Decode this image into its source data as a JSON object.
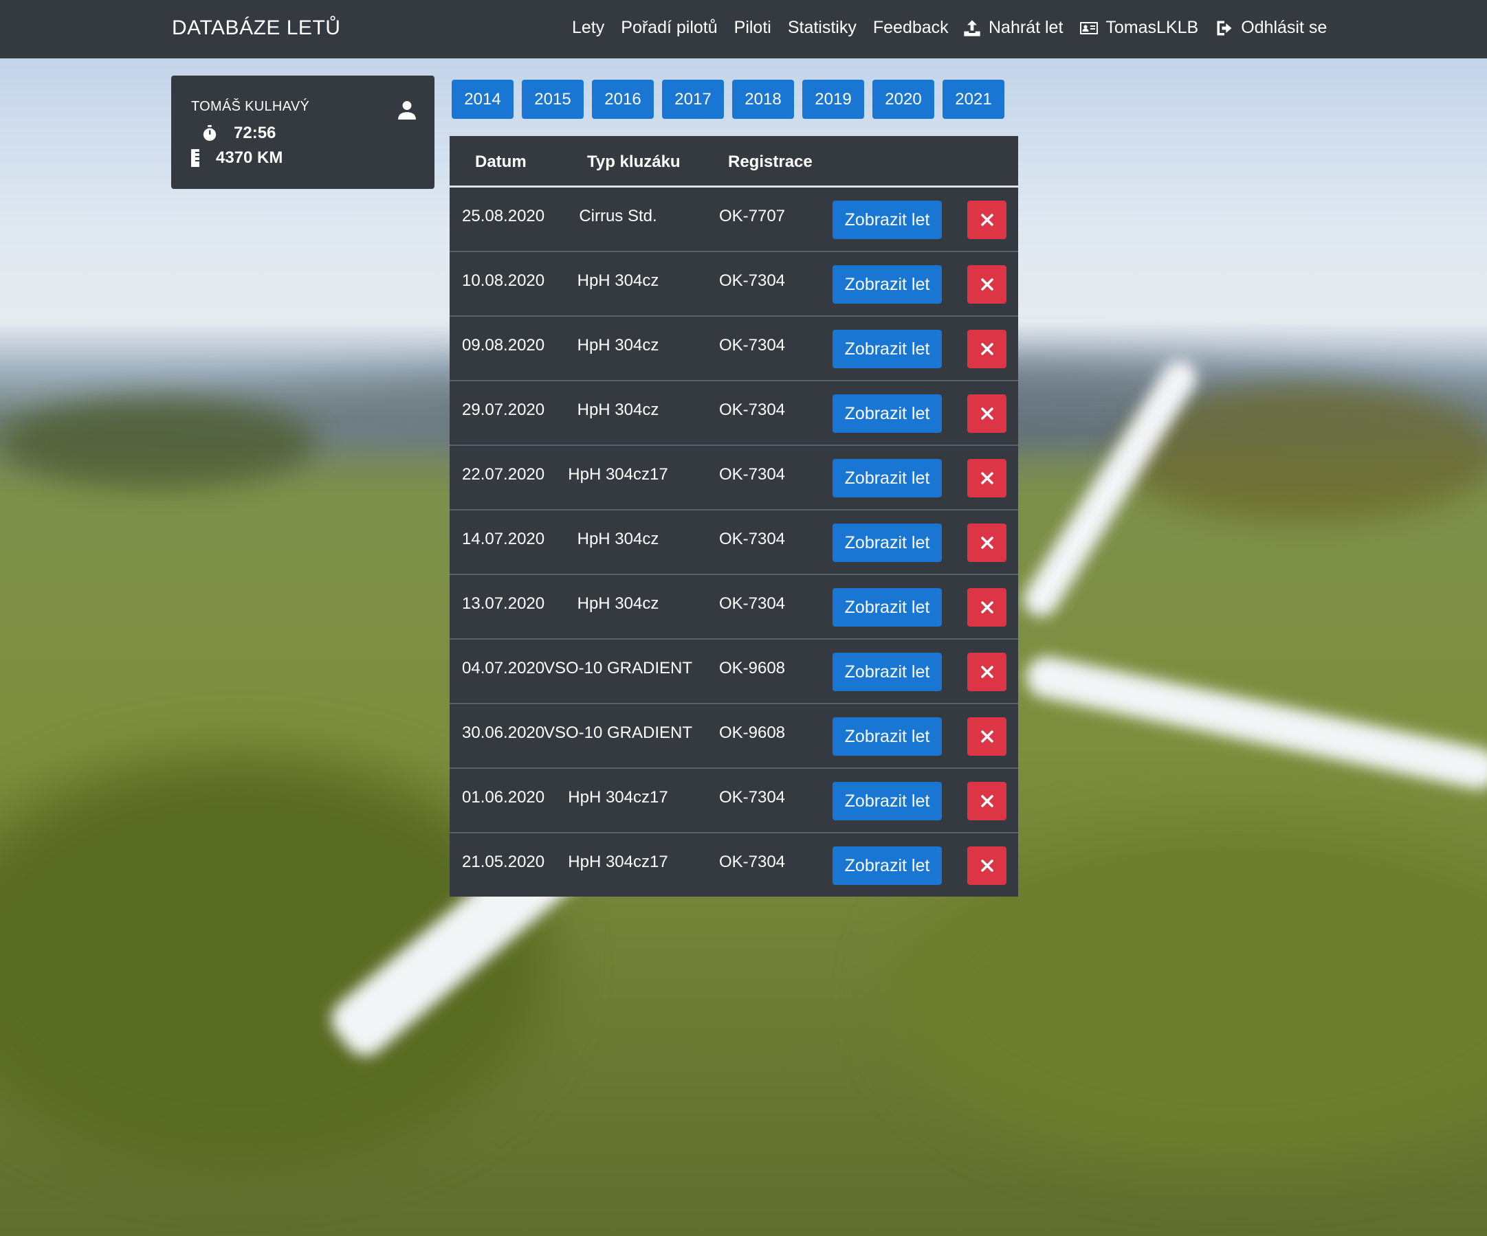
{
  "navbar": {
    "brand": "DATABÁZE LETŮ",
    "links": [
      "Lety",
      "Pořadí pilotů",
      "Piloti",
      "Statistiky",
      "Feedback"
    ],
    "upload_label": "Nahrát let",
    "user_label": "TomasLKLB",
    "logout_label": "Odhlásit se"
  },
  "profile": {
    "name": "TOMÁŠ KULHAVÝ",
    "time": "72:56",
    "distance": "4370 KM"
  },
  "years": [
    "2014",
    "2015",
    "2016",
    "2017",
    "2018",
    "2019",
    "2020",
    "2021"
  ],
  "table": {
    "headers": [
      "Datum",
      "Typ kluzáku",
      "Registrace"
    ],
    "view_label": "Zobrazit let",
    "rows": [
      {
        "date": "25.08.2020",
        "type": "Cirrus Std.",
        "reg": "OK-7707"
      },
      {
        "date": "10.08.2020",
        "type": "HpH 304cz",
        "reg": "OK-7304"
      },
      {
        "date": "09.08.2020",
        "type": "HpH 304cz",
        "reg": "OK-7304"
      },
      {
        "date": "29.07.2020",
        "type": "HpH 304cz",
        "reg": "OK-7304"
      },
      {
        "date": "22.07.2020",
        "type": "HpH 304cz17",
        "reg": "OK-7304"
      },
      {
        "date": "14.07.2020",
        "type": "HpH 304cz",
        "reg": "OK-7304"
      },
      {
        "date": "13.07.2020",
        "type": "HpH 304cz",
        "reg": "OK-7304"
      },
      {
        "date": "04.07.2020",
        "type": "VSO-10 GRADIENT",
        "reg": "OK-9608"
      },
      {
        "date": "30.06.2020",
        "type": "VSO-10 GRADIENT",
        "reg": "OK-9608"
      },
      {
        "date": "01.06.2020",
        "type": "HpH 304cz17",
        "reg": "OK-7304"
      },
      {
        "date": "21.05.2020",
        "type": "HpH 304cz17",
        "reg": "OK-7304"
      }
    ]
  },
  "colors": {
    "navbar": "#343a40",
    "primary": "#1976d2",
    "danger": "#dc3545"
  }
}
